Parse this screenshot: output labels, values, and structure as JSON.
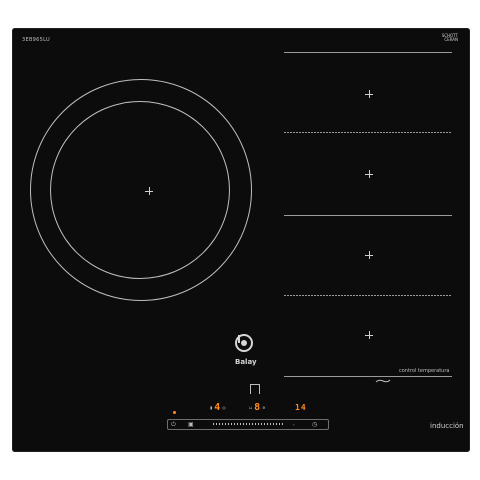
{
  "model_code": "3EB965LU",
  "glass_brand": [
    "SCHOTT",
    "CERAN"
  ],
  "brand": "Balay",
  "zone_feature_label": "control temperatura",
  "technology_label": "inducción",
  "displays": {
    "left_power": "4",
    "center_power": "8",
    "timer": "14"
  },
  "colors": {
    "glass": "#0c0c0c",
    "lines": "#9a9a9a",
    "display": "#ff8a1c"
  },
  "icons": [
    "plus-icon",
    "balay-logo-icon",
    "power-icon",
    "timer-icon",
    "lock-icon"
  ]
}
